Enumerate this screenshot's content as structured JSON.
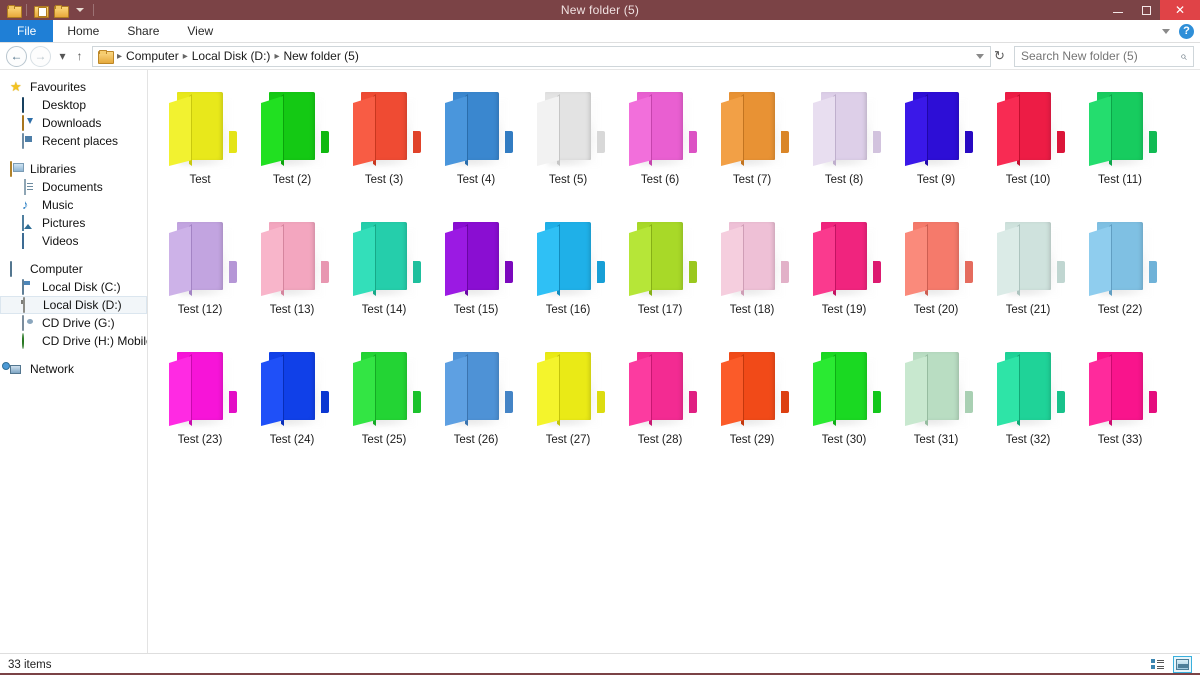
{
  "window": {
    "title": "New folder (5)",
    "quick_access": [
      "folder-icon",
      "properties-icon",
      "new-folder-icon",
      "customize-dropdown-icon"
    ],
    "minimize_label": "Minimize",
    "maximize_label": "Restore",
    "close_label": "Close"
  },
  "ribbon": {
    "tabs": [
      {
        "label": "File",
        "active": true
      },
      {
        "label": "Home",
        "active": false
      },
      {
        "label": "Share",
        "active": false
      },
      {
        "label": "View",
        "active": false
      }
    ],
    "collapse_label": "Minimize the Ribbon",
    "help_label": "?"
  },
  "addressbar": {
    "back_label": "←",
    "forward_label": "→",
    "recent_label": "▾",
    "up_label": "↑",
    "breadcrumbs": [
      "Computer",
      "Local Disk (D:)",
      "New folder (5)"
    ],
    "separator": "▸",
    "dropdown_label": "▾",
    "refresh_label": "↻",
    "search_placeholder": "Search New folder (5)",
    "search_value": "",
    "search_icon": "search-icon"
  },
  "sidebar": {
    "groups": [
      {
        "header": {
          "label": "Favourites",
          "icon": "star-icon"
        },
        "items": [
          {
            "label": "Desktop",
            "icon": "desktop-icon"
          },
          {
            "label": "Downloads",
            "icon": "downloads-icon"
          },
          {
            "label": "Recent places",
            "icon": "recent-places-icon"
          }
        ]
      },
      {
        "header": {
          "label": "Libraries",
          "icon": "libraries-icon"
        },
        "items": [
          {
            "label": "Documents",
            "icon": "documents-icon"
          },
          {
            "label": "Music",
            "icon": "music-icon"
          },
          {
            "label": "Pictures",
            "icon": "pictures-icon"
          },
          {
            "label": "Videos",
            "icon": "videos-icon"
          }
        ]
      },
      {
        "header": {
          "label": "Computer",
          "icon": "computer-icon"
        },
        "items": [
          {
            "label": "Local Disk (C:)",
            "icon": "hard-disk-icon",
            "selected": false
          },
          {
            "label": "Local Disk (D:)",
            "icon": "hard-disk-icon",
            "selected": true
          },
          {
            "label": "CD Drive (G:)",
            "icon": "cd-drive-icon",
            "selected": false
          },
          {
            "label": "CD Drive (H:) Mobile F",
            "icon": "cd-drive-green-icon",
            "selected": false
          }
        ]
      },
      {
        "header": {
          "label": "Network",
          "icon": "network-icon"
        },
        "items": []
      }
    ]
  },
  "content": {
    "items": [
      {
        "label": "Test",
        "main": "#e8e81b",
        "front": "#f2f230",
        "tab": "#e4e417",
        "spine": "#c9c90e"
      },
      {
        "label": "Test (2)",
        "main": "#14c914",
        "front": "#21e021",
        "tab": "#10b910",
        "spine": "#0ba30b"
      },
      {
        "label": "Test (3)",
        "main": "#ef4b33",
        "front": "#f85c44",
        "tab": "#e04229",
        "spine": "#c8371f"
      },
      {
        "label": "Test (4)",
        "main": "#3a87cf",
        "front": "#4a96dc",
        "tab": "#327cc2",
        "spine": "#2a6dab"
      },
      {
        "label": "Test (5)",
        "main": "#e3e3e3",
        "front": "#f2f2f2",
        "tab": "#d8d8d8",
        "spine": "#c6c6c6"
      },
      {
        "label": "Test (6)",
        "main": "#e95fd1",
        "front": "#f26fdb",
        "tab": "#dc52c4",
        "spine": "#c544ad"
      },
      {
        "label": "Test (7)",
        "main": "#e89234",
        "front": "#f2a046",
        "tab": "#da8628",
        "spine": "#c27420"
      },
      {
        "label": "Test (8)",
        "main": "#ddcfe8",
        "front": "#e8def0",
        "tab": "#d2c3de",
        "spine": "#bfafcd"
      },
      {
        "label": "Test (9)",
        "main": "#2d0ed6",
        "front": "#3a18e8",
        "tab": "#2709c2",
        "spine": "#2007a8"
      },
      {
        "label": "Test (10)",
        "main": "#ed1c45",
        "front": "#f82b53",
        "tab": "#db1539",
        "spine": "#c20f2f"
      },
      {
        "label": "Test (11)",
        "main": "#17cc5f",
        "front": "#24dd6e",
        "tab": "#11bb54",
        "spine": "#0ca549"
      },
      {
        "label": "Test (12)",
        "main": "#c2a4e0",
        "front": "#cdb2e8",
        "tab": "#b596d6",
        "spine": "#a384c4"
      },
      {
        "label": "Test (13)",
        "main": "#f3a6bf",
        "front": "#f8b5ca",
        "tab": "#e897b1",
        "spine": "#d5859e"
      },
      {
        "label": "Test (14)",
        "main": "#25ceab",
        "front": "#33dfba",
        "tab": "#1ebf9d",
        "spine": "#17a988"
      },
      {
        "label": "Test (15)",
        "main": "#8a0ed2",
        "front": "#9b1ae3",
        "tab": "#7b08bd",
        "spine": "#6a06a4"
      },
      {
        "label": "Test (16)",
        "main": "#1fb0e8",
        "front": "#2fc0f5",
        "tab": "#179fd6",
        "spine": "#128cbe"
      },
      {
        "label": "Test (17)",
        "main": "#a8d928",
        "front": "#b6e638",
        "tab": "#9ac81e",
        "spine": "#86b016"
      },
      {
        "label": "Test (18)",
        "main": "#eec0d6",
        "front": "#f5cede",
        "tab": "#e2b1c8",
        "spine": "#cf9eb6"
      },
      {
        "label": "Test (19)",
        "main": "#f0247e",
        "front": "#fa3a8e",
        "tab": "#dc1a70",
        "spine": "#c31362"
      },
      {
        "label": "Test (20)",
        "main": "#f57a6b",
        "front": "#fa8a7b",
        "tab": "#e56c5e",
        "spine": "#cd5e51"
      },
      {
        "label": "Test (21)",
        "main": "#cfe2dd",
        "front": "#dbebe7",
        "tab": "#c0d6d1",
        "spine": "#adc4bf"
      },
      {
        "label": "Test (22)",
        "main": "#7fc0e3",
        "front": "#8fcdee",
        "tab": "#6fb2d8",
        "spine": "#619ec2"
      },
      {
        "label": "Test (23)",
        "main": "#f714d8",
        "front": "#ff2ae3",
        "tab": "#e30ec6",
        "spine": "#c80bad"
      },
      {
        "label": "Test (24)",
        "main": "#1040e8",
        "front": "#1f50f8",
        "tab": "#0b37d2",
        "spine": "#082eb8"
      },
      {
        "label": "Test (25)",
        "main": "#23d434",
        "front": "#33e544",
        "tab": "#1bc22c",
        "spine": "#15aa25"
      },
      {
        "label": "Test (26)",
        "main": "#4e92d6",
        "front": "#5ea0e2",
        "tab": "#4484c6",
        "spine": "#3b74af"
      },
      {
        "label": "Test (27)",
        "main": "#eaea16",
        "front": "#f4f42c",
        "tab": "#dcdc10",
        "spine": "#c4c40b"
      },
      {
        "label": "Test (28)",
        "main": "#f32b92",
        "front": "#fc3ba0",
        "tab": "#e01f82",
        "spine": "#c71872"
      },
      {
        "label": "Test (29)",
        "main": "#f14a18",
        "front": "#fb5b29",
        "tab": "#dd4011",
        "spine": "#c3380d"
      },
      {
        "label": "Test (30)",
        "main": "#1ad922",
        "front": "#2aea32",
        "tab": "#13c71b",
        "spine": "#0eae16"
      },
      {
        "label": "Test (31)",
        "main": "#b9ddc2",
        "front": "#c8e8cf",
        "tab": "#a9d0b3",
        "spine": "#96bca0"
      },
      {
        "label": "Test (32)",
        "main": "#1fd398",
        "front": "#2ee4a7",
        "tab": "#18c28b",
        "spine": "#12a876"
      },
      {
        "label": "Test (33)",
        "main": "#f9148c",
        "front": "#ff2a9c",
        "tab": "#e50d7e",
        "spine": "#cb0a6f"
      }
    ]
  },
  "statusbar": {
    "item_count": "33 items",
    "views": [
      {
        "name": "details-view",
        "active": false
      },
      {
        "name": "large-icons-view",
        "active": true
      }
    ]
  }
}
